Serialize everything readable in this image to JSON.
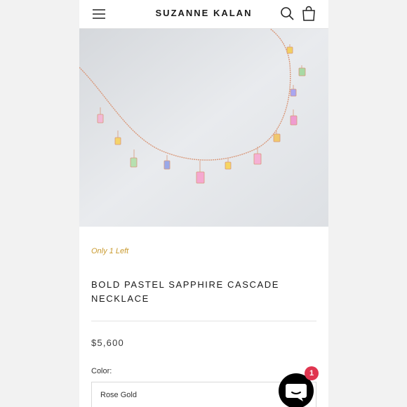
{
  "header": {
    "brand": "SUZANNE KALAN",
    "menu_icon": "hamburger-menu-icon",
    "search_icon": "search-icon",
    "cart_icon": "shopping-bag-icon"
  },
  "product": {
    "stock_status": "Only 1 Left",
    "title": "BOLD PASTEL SAPPHIRE CASCADE NECKLACE",
    "price": "$5,600",
    "color_label": "Color:",
    "color_value": "Rose Gold"
  },
  "chat": {
    "icon": "chat-bubble-icon",
    "badge_count": "1"
  },
  "colors": {
    "stock_accent": "#c99a2e",
    "badge": "#e0354f",
    "chain": "#d9987a"
  }
}
